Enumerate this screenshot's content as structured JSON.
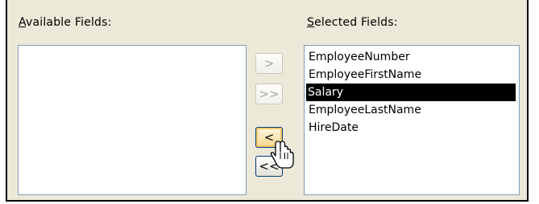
{
  "available": {
    "label_underlined": "A",
    "label_rest": "vailable Fields:",
    "items": []
  },
  "selected": {
    "label_underlined": "S",
    "label_rest": "elected Fields:",
    "items": [
      "EmployeeNumber",
      "EmployeeFirstName",
      "Salary",
      "EmployeeLastName",
      "HireDate"
    ],
    "highlighted_item": "Salary"
  },
  "buttons": {
    "add_one": ">",
    "add_all": ">>",
    "remove_one": "<",
    "remove_all": "<<"
  },
  "icons": {
    "cursor": "hand-pointer-icon"
  },
  "colors": {
    "panel_bg": "#ece9d8",
    "selection_bg": "#000000",
    "list_border": "#7f9db9"
  }
}
